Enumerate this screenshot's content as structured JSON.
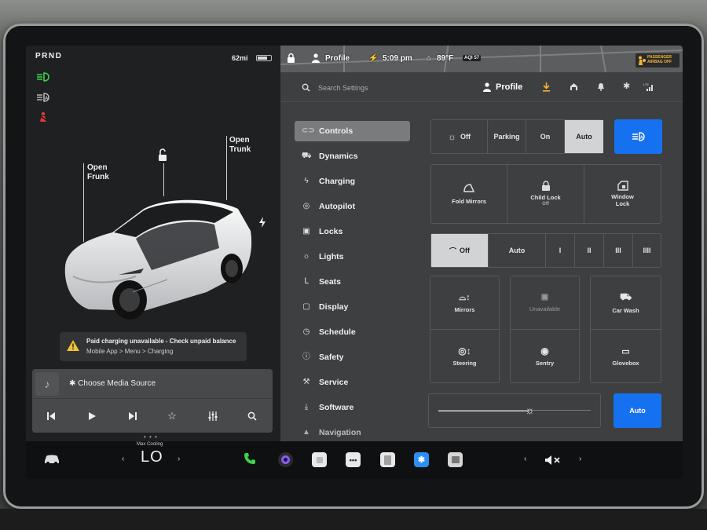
{
  "status": {
    "gear": "PRND",
    "range": "62mi",
    "profile": "Profile",
    "time": "5:09 pm",
    "temperature": "89°F",
    "aqi": "AQI 57",
    "airbag": "PASSENGER AIRBAG OFF"
  },
  "car_view": {
    "frunk_label": "Open\nFrunk",
    "trunk_label": "Open\nTrunk",
    "notice_title": "Paid charging unavailable - Check unpaid balance",
    "notice_sub": "Mobile App > Menu > Charging"
  },
  "media": {
    "source_label": "Choose Media Source",
    "page_dots": "• • •"
  },
  "settings": {
    "search_placeholder": "Search Settings",
    "header_profile": "Profile",
    "menu": [
      {
        "label": "Controls",
        "icon": "toggle-icon"
      },
      {
        "label": "Dynamics",
        "icon": "car-icon"
      },
      {
        "label": "Charging",
        "icon": "bolt-icon"
      },
      {
        "label": "Autopilot",
        "icon": "steering-wheel-icon"
      },
      {
        "label": "Locks",
        "icon": "lock-icon"
      },
      {
        "label": "Lights",
        "icon": "sun-icon"
      },
      {
        "label": "Seats",
        "icon": "seat-icon"
      },
      {
        "label": "Display",
        "icon": "display-icon"
      },
      {
        "label": "Schedule",
        "icon": "clock-icon"
      },
      {
        "label": "Safety",
        "icon": "info-icon"
      },
      {
        "label": "Service",
        "icon": "wrench-icon"
      },
      {
        "label": "Software",
        "icon": "download-icon"
      },
      {
        "label": "Navigation",
        "icon": "navigation-icon"
      }
    ],
    "headlights": {
      "options": [
        "Off",
        "Parking",
        "On",
        "Auto"
      ],
      "selected": "Auto"
    },
    "tiles_row1": [
      {
        "label": "Fold Mirrors",
        "sub": ""
      },
      {
        "label": "Child Lock",
        "sub": "Off"
      },
      {
        "label": "Window\nLock",
        "sub": ""
      }
    ],
    "wipers": {
      "options": [
        "Off",
        "Auto",
        "I",
        "II",
        "III",
        "IIII"
      ],
      "selected": "Off"
    },
    "tiles_grid": [
      {
        "label": "Mirrors"
      },
      {
        "label": "Unavailable"
      },
      {
        "label": "Car Wash"
      },
      {
        "label": "Steering"
      },
      {
        "label": "Sentry"
      },
      {
        "label": "Glovebox"
      }
    ],
    "brightness_auto": "Auto",
    "brightness_level": 0.6
  },
  "dock": {
    "climate_label": "Max Cooling",
    "climate_value": "LO"
  },
  "colors": {
    "accent": "#1671f0",
    "green_telltale": "#3fd24a",
    "red_telltale": "#e53935"
  }
}
